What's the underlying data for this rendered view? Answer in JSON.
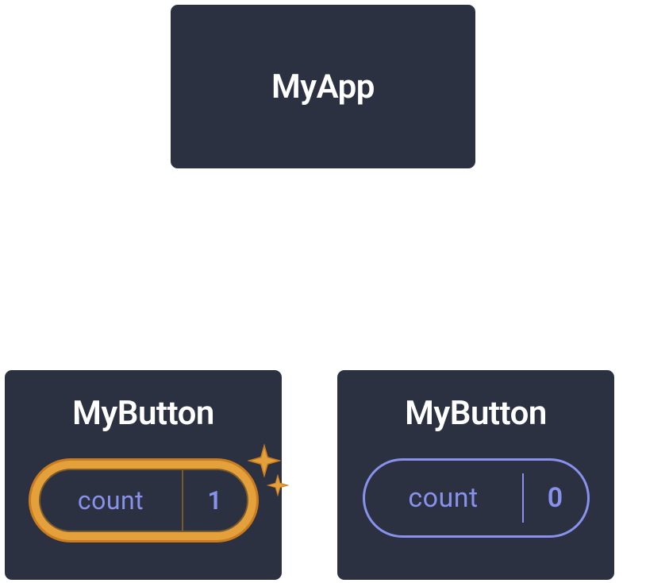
{
  "tree": {
    "root": {
      "label": "MyApp"
    },
    "children": [
      {
        "label": "MyButton",
        "highlighted": true,
        "state": {
          "name": "count",
          "value": "1"
        }
      },
      {
        "label": "MyButton",
        "highlighted": false,
        "state": {
          "name": "count",
          "value": "0"
        }
      }
    ]
  },
  "colors": {
    "node_bg": "#2b3140",
    "node_border": "#ffffff",
    "pill_border": "#8891ec",
    "pill_text": "#8891ec",
    "highlight_outer": "#c87b1f",
    "highlight_inner": "#e4a03a"
  }
}
